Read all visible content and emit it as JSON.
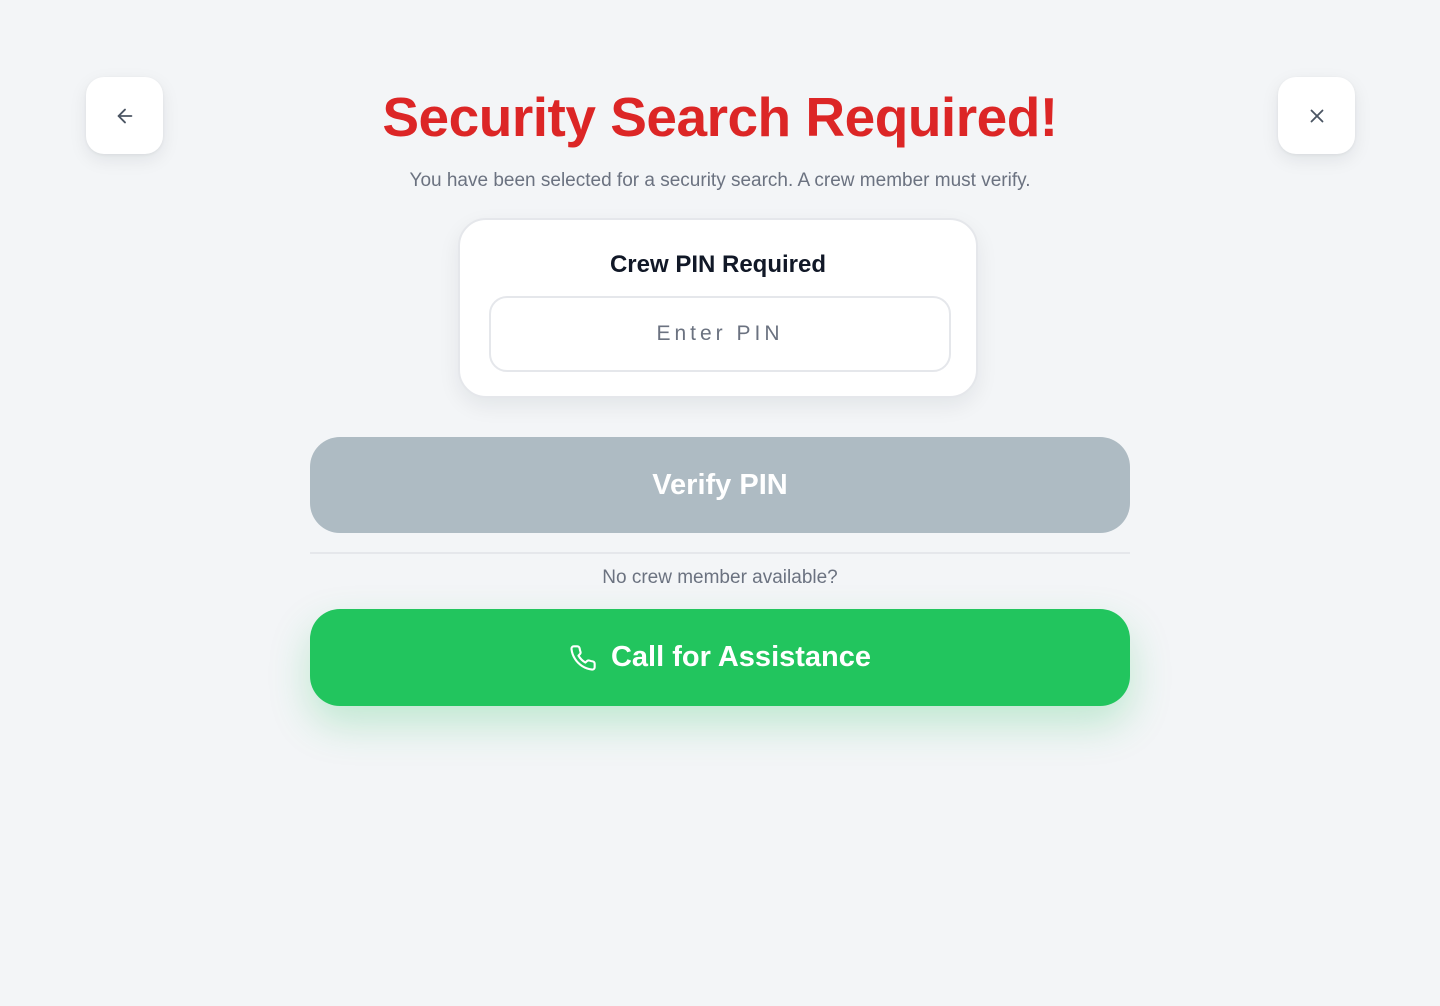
{
  "header": {
    "back_icon": "arrow-left-icon",
    "close_icon": "close-icon",
    "title": "Security Search Required!",
    "subtitle": "You have been selected for a security search. A crew member must verify."
  },
  "pin_card": {
    "title": "Crew PIN Required",
    "input_placeholder": "Enter PIN",
    "input_value": ""
  },
  "verify_button": {
    "label": "Verify PIN",
    "state": "disabled"
  },
  "fallback": {
    "prompt": "No crew member available?",
    "call_button_label": "Call for Assistance",
    "call_icon": "phone-icon"
  },
  "colors": {
    "background": "#f3f5f7",
    "title": "#dc2626",
    "verify_disabled": "#aebbc3",
    "call_button": "#22c55e"
  }
}
